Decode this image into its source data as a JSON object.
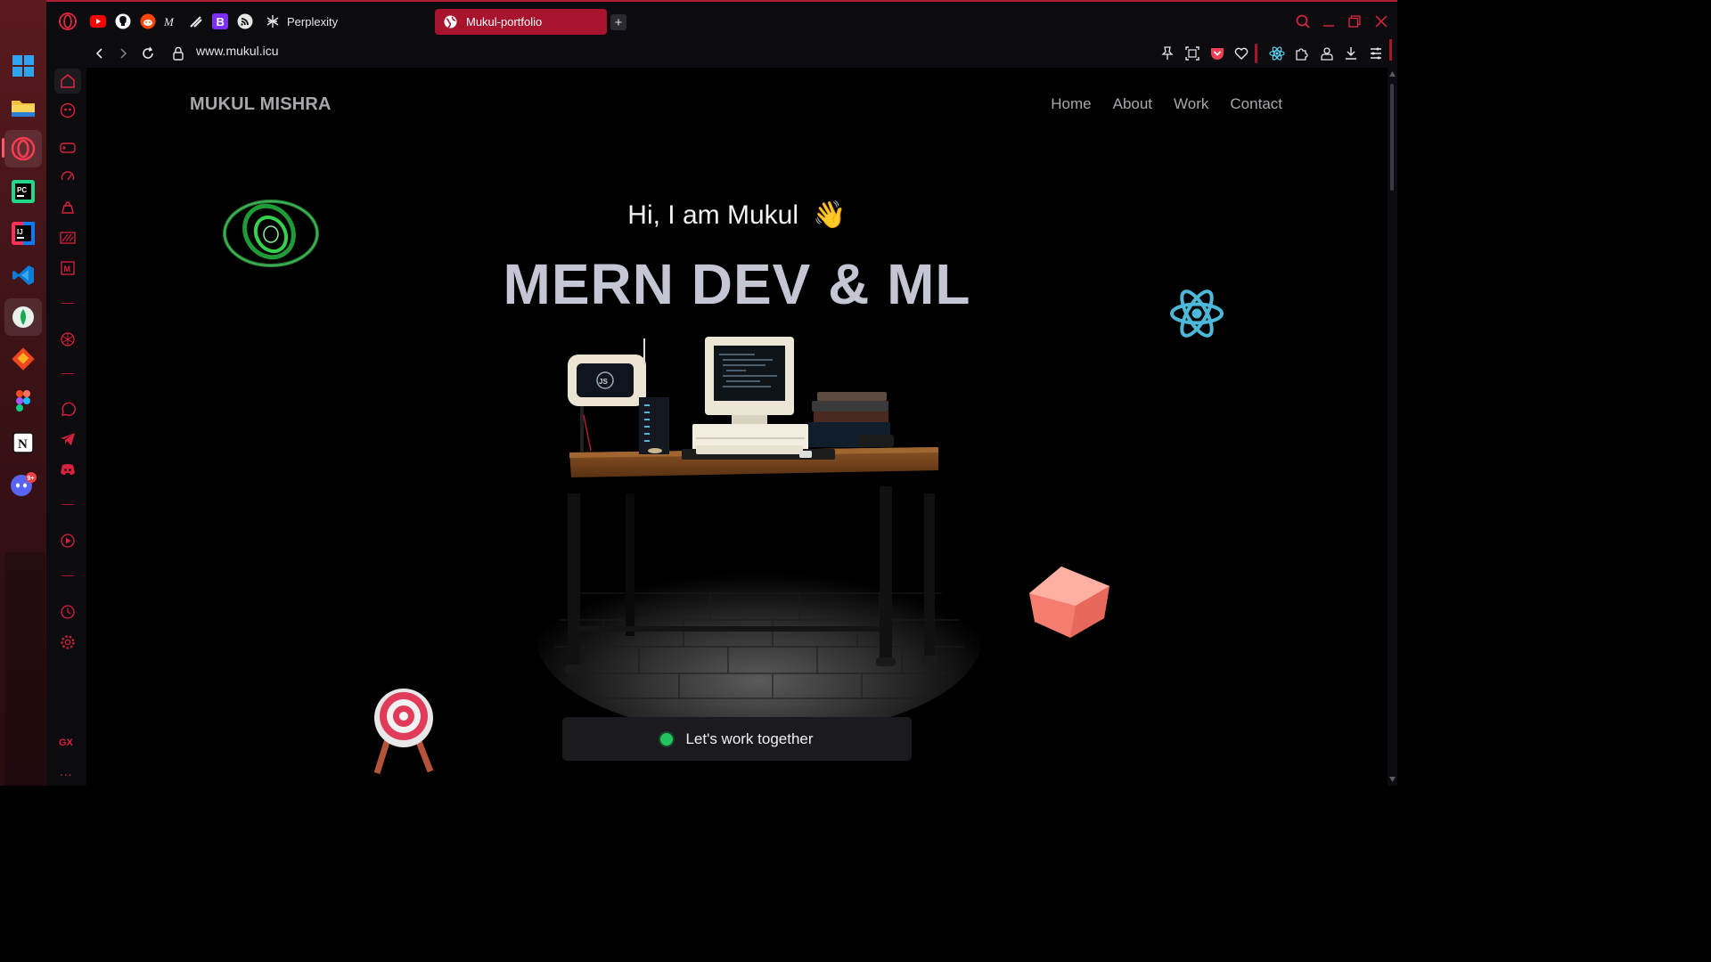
{
  "taskbar": {
    "items": [
      {
        "name": "windows-start-icon"
      },
      {
        "name": "file-explorer-icon"
      },
      {
        "name": "opera-gx-icon"
      },
      {
        "name": "pycharm-icon"
      },
      {
        "name": "intellij-icon"
      },
      {
        "name": "vscode-icon"
      },
      {
        "name": "mongodb-compass-icon"
      },
      {
        "name": "git-icon"
      },
      {
        "name": "figma-icon"
      },
      {
        "name": "notion-icon"
      },
      {
        "name": "discord-icon",
        "badge": "9+"
      }
    ]
  },
  "browser": {
    "speed_dial": [
      "opera-logo-icon",
      "youtube-icon",
      "github-icon",
      "reddit-icon",
      "medium-icon",
      "pen-icon",
      "bootstrap-icon",
      "rss-icon"
    ],
    "perplexity_label": "Perplexity",
    "active_tab_title": "Mukul-portfolio",
    "new_tab_label": "+",
    "url": "www.mukul.icu",
    "sidebar": {
      "gx_label": "GX",
      "more_label": "..."
    }
  },
  "site": {
    "brand": "MUKUL MISHRA",
    "nav": [
      "Home",
      "About",
      "Work",
      "Contact"
    ],
    "greeting": "Hi, I am Mukul",
    "greeting_emoji": "👋",
    "hero_title": "MERN DEV & ML",
    "cta_label": "Let's work together"
  },
  "colors": {
    "accent": "#a8142d",
    "cta_dot": "#22c55e",
    "hero_title": "#c4c6d4"
  }
}
